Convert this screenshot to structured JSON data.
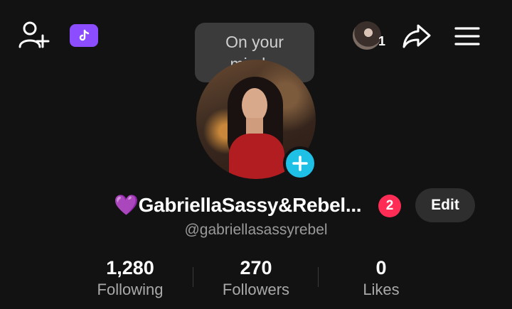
{
  "topbar": {
    "add_friend_icon": "person-plus-icon",
    "ticket_icon": "music-ticket-icon",
    "story_count": "1",
    "share_icon": "share-arrow-icon",
    "menu_icon": "hamburger-menu-icon"
  },
  "tooltip": {
    "line1": "On your",
    "line2": "mind..."
  },
  "profile": {
    "emoji": "💜",
    "display_name": "GabriellaSassy&Rebel...",
    "notification_count": "2",
    "edit_label": "Edit",
    "username": "@gabriellasassyrebel"
  },
  "stats": [
    {
      "value": "1,280",
      "label": "Following"
    },
    {
      "value": "270",
      "label": "Followers"
    },
    {
      "value": "0",
      "label": "Likes"
    }
  ],
  "colors": {
    "background": "#121212",
    "accent_purple": "#8b4dff",
    "add_button": "#1ec0e6",
    "badge": "#ff2d55"
  }
}
